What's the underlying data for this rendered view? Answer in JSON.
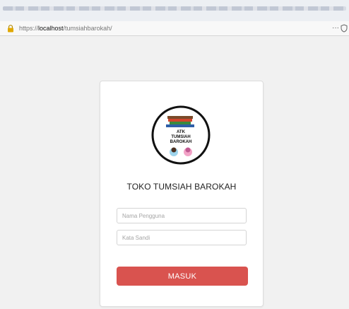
{
  "browser": {
    "url_scheme": "https://",
    "url_host": "localhost",
    "url_path": "/tumsiahbarokah/",
    "menu_glyph": "···"
  },
  "login": {
    "logo_lines": [
      "ATK",
      "TUMSIAH",
      "BAROKAH"
    ],
    "title": "TOKO TUMSIAH BAROKAH",
    "username_placeholder": "Nama Pengguna",
    "password_placeholder": "Kata Sandi",
    "submit_label": "MASUK"
  },
  "colors": {
    "page_background": "#f1f1f1",
    "button": "#d9534f",
    "button_text": "#ffffff"
  },
  "icons": {
    "lock": "lock-icon",
    "shield": "shield-icon",
    "menu": "more-icon"
  }
}
